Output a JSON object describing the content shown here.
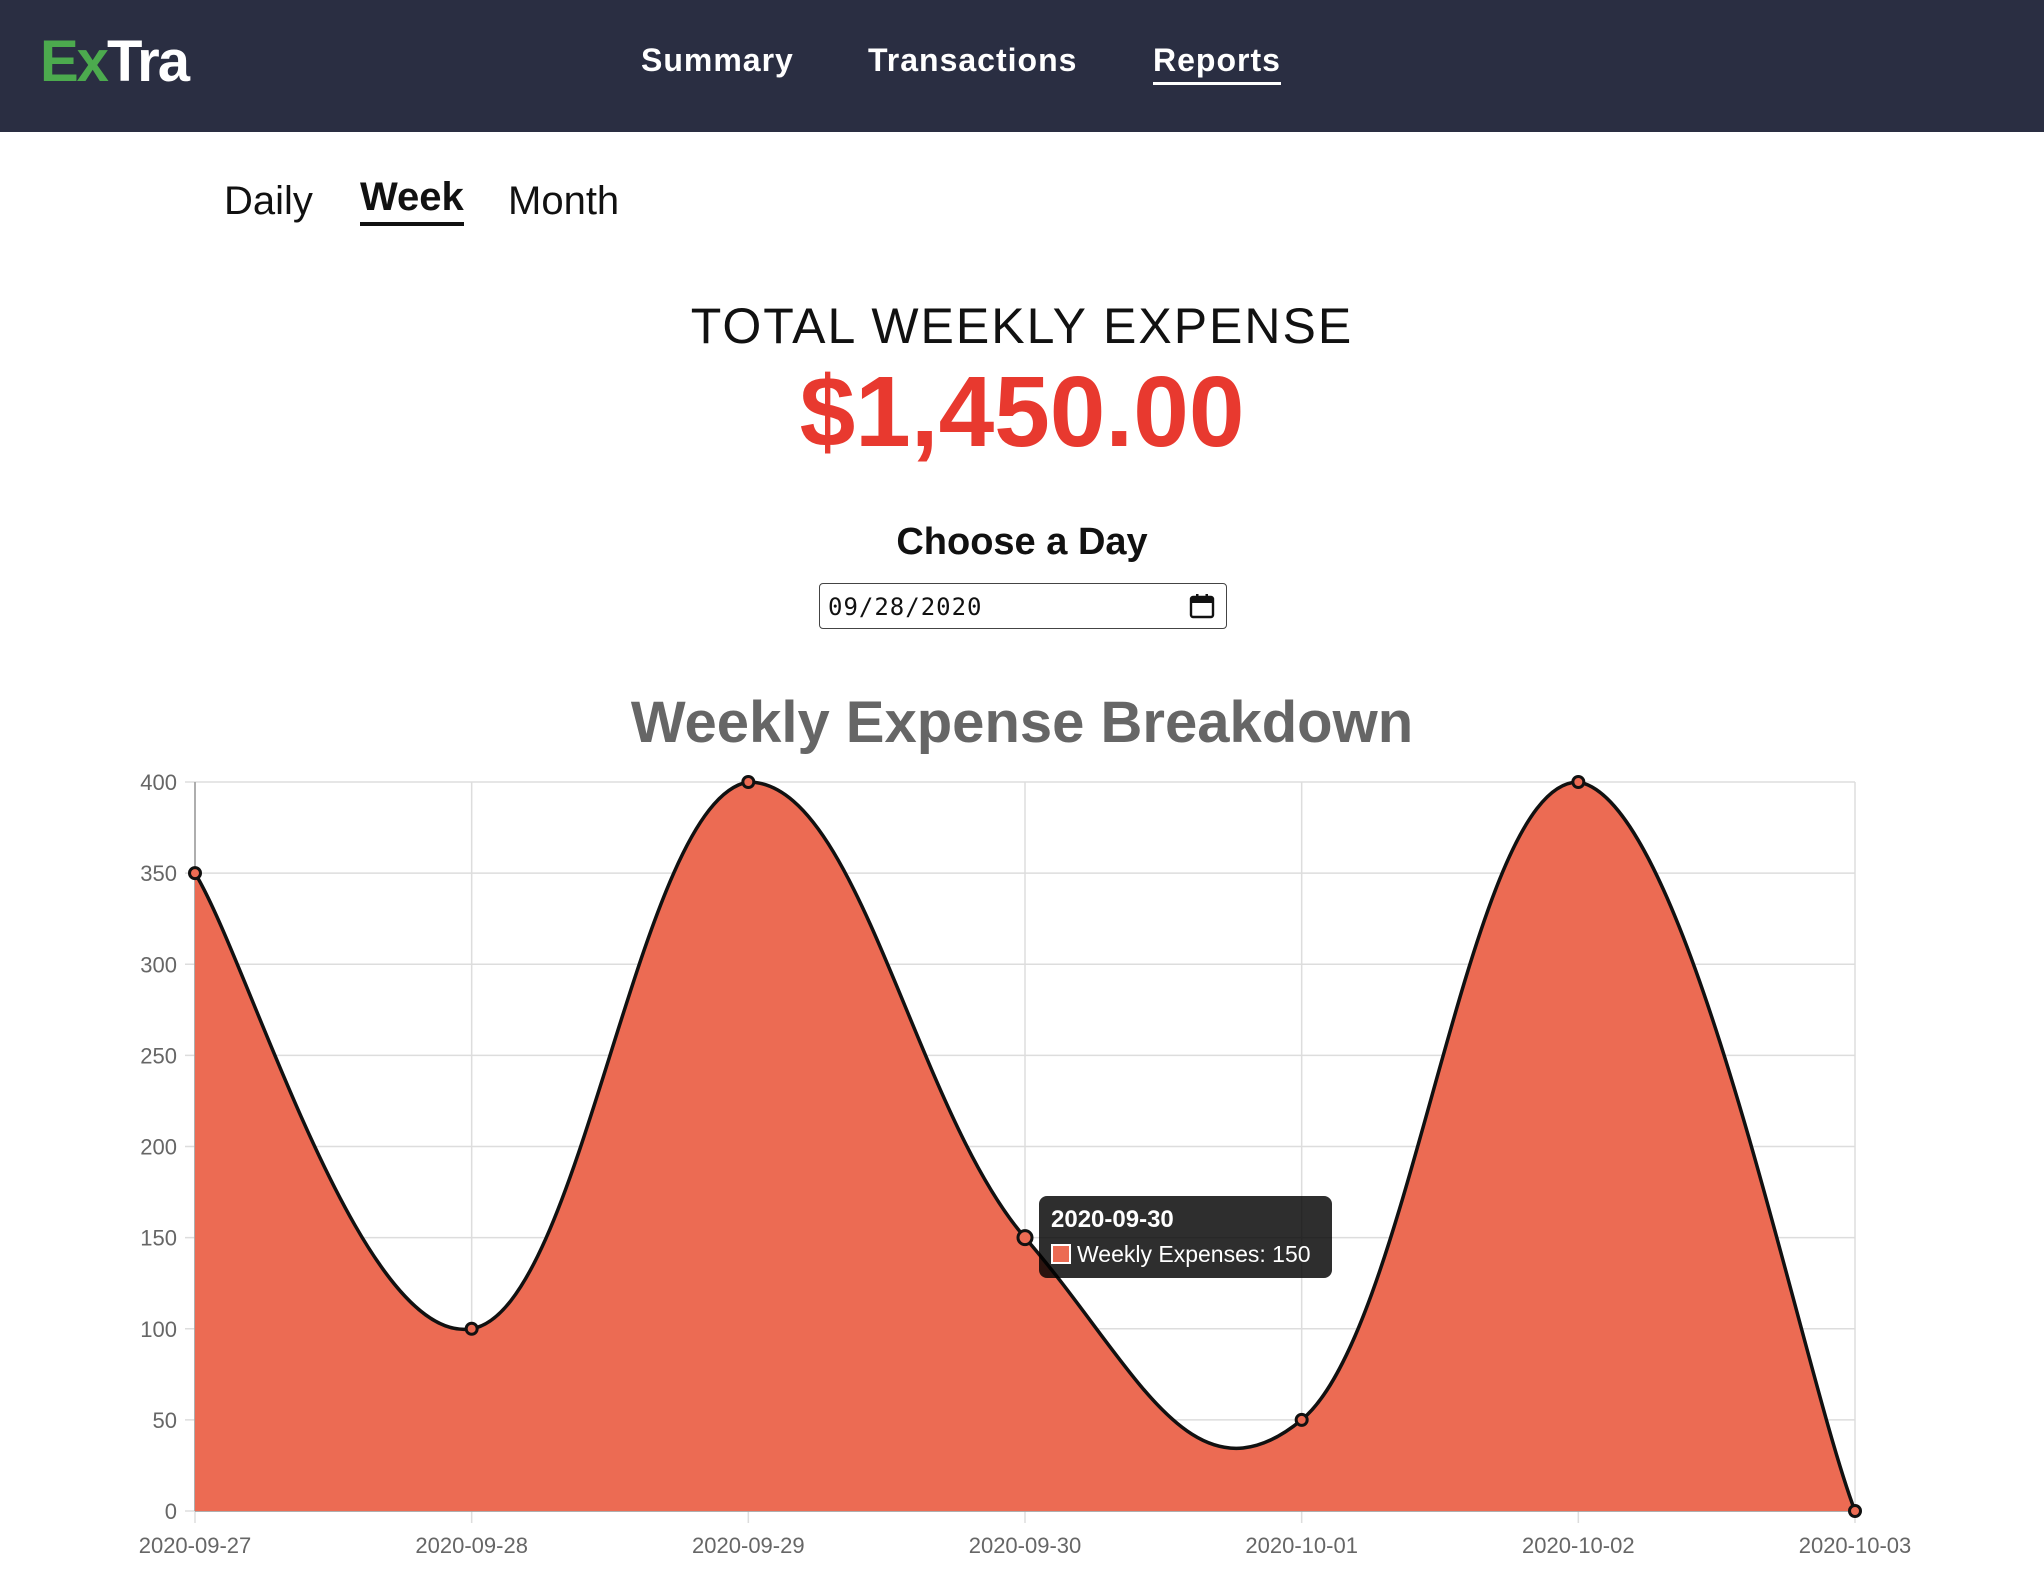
{
  "app": {
    "logo_part1": "Ex",
    "logo_part2": "Tra",
    "logo_color_1": "#4caa4e",
    "logo_color_2": "#ffffff",
    "header_bg": "#2a2e42"
  },
  "nav": {
    "items": [
      {
        "label": "Summary",
        "active": false
      },
      {
        "label": "Transactions",
        "active": false
      },
      {
        "label": "Reports",
        "active": true
      }
    ]
  },
  "subtabs": {
    "items": [
      {
        "label": "Daily",
        "active": false
      },
      {
        "label": "Week",
        "active": true
      },
      {
        "label": "Month",
        "active": false
      }
    ]
  },
  "summary": {
    "label": "TOTAL WEEKLY EXPENSE",
    "value": "$1,450.00",
    "value_color": "#e8392f"
  },
  "date_picker": {
    "label": "Choose a Day",
    "value": "09/28/2020",
    "icon": "calendar-icon"
  },
  "tooltip": {
    "title": "2020-09-30",
    "text": "Weekly Expenses: 150"
  },
  "chart_data": {
    "type": "area",
    "title": "Weekly Expense Breakdown",
    "categories": [
      "2020-09-27",
      "2020-09-28",
      "2020-09-29",
      "2020-09-30",
      "2020-10-01",
      "2020-10-02",
      "2020-10-03"
    ],
    "series": [
      {
        "name": "Weekly Expenses",
        "values": [
          350,
          100,
          400,
          150,
          50,
          400,
          0
        ],
        "color": "#ec6b53"
      }
    ],
    "ylim": [
      0,
      400
    ],
    "yticks": [
      0,
      50,
      100,
      150,
      200,
      250,
      300,
      350,
      400
    ],
    "grid": true,
    "legend": "none"
  }
}
